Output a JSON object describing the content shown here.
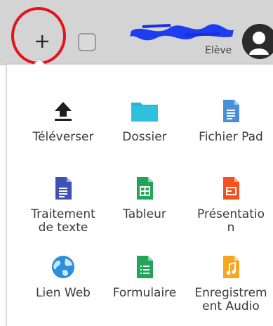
{
  "user": {
    "role": "Elève"
  },
  "menu": {
    "items": [
      {
        "label": "Téléverser",
        "icon": "upload-icon"
      },
      {
        "label": "Dossier",
        "icon": "folder-icon"
      },
      {
        "label": "Fichier Pad",
        "icon": "pad-file-icon"
      },
      {
        "label": "Traitement\nde texte",
        "icon": "text-document-icon"
      },
      {
        "label": "Tableur",
        "icon": "spreadsheet-icon"
      },
      {
        "label": "Présentatio\nn",
        "icon": "presentation-icon"
      },
      {
        "label": "Lien Web",
        "icon": "globe-icon"
      },
      {
        "label": "Formulaire",
        "icon": "form-icon"
      },
      {
        "label": "Enregistrem\nent Audio",
        "icon": "audio-icon"
      }
    ]
  },
  "colors": {
    "highlight": "#e2141d",
    "folder": "#29b6d6",
    "pad": "#4a90d9",
    "doc": "#3f51b5",
    "sheet": "#22a559",
    "slides": "#f4511e",
    "audio": "#f5a623",
    "globe": "#2a8fdc"
  }
}
